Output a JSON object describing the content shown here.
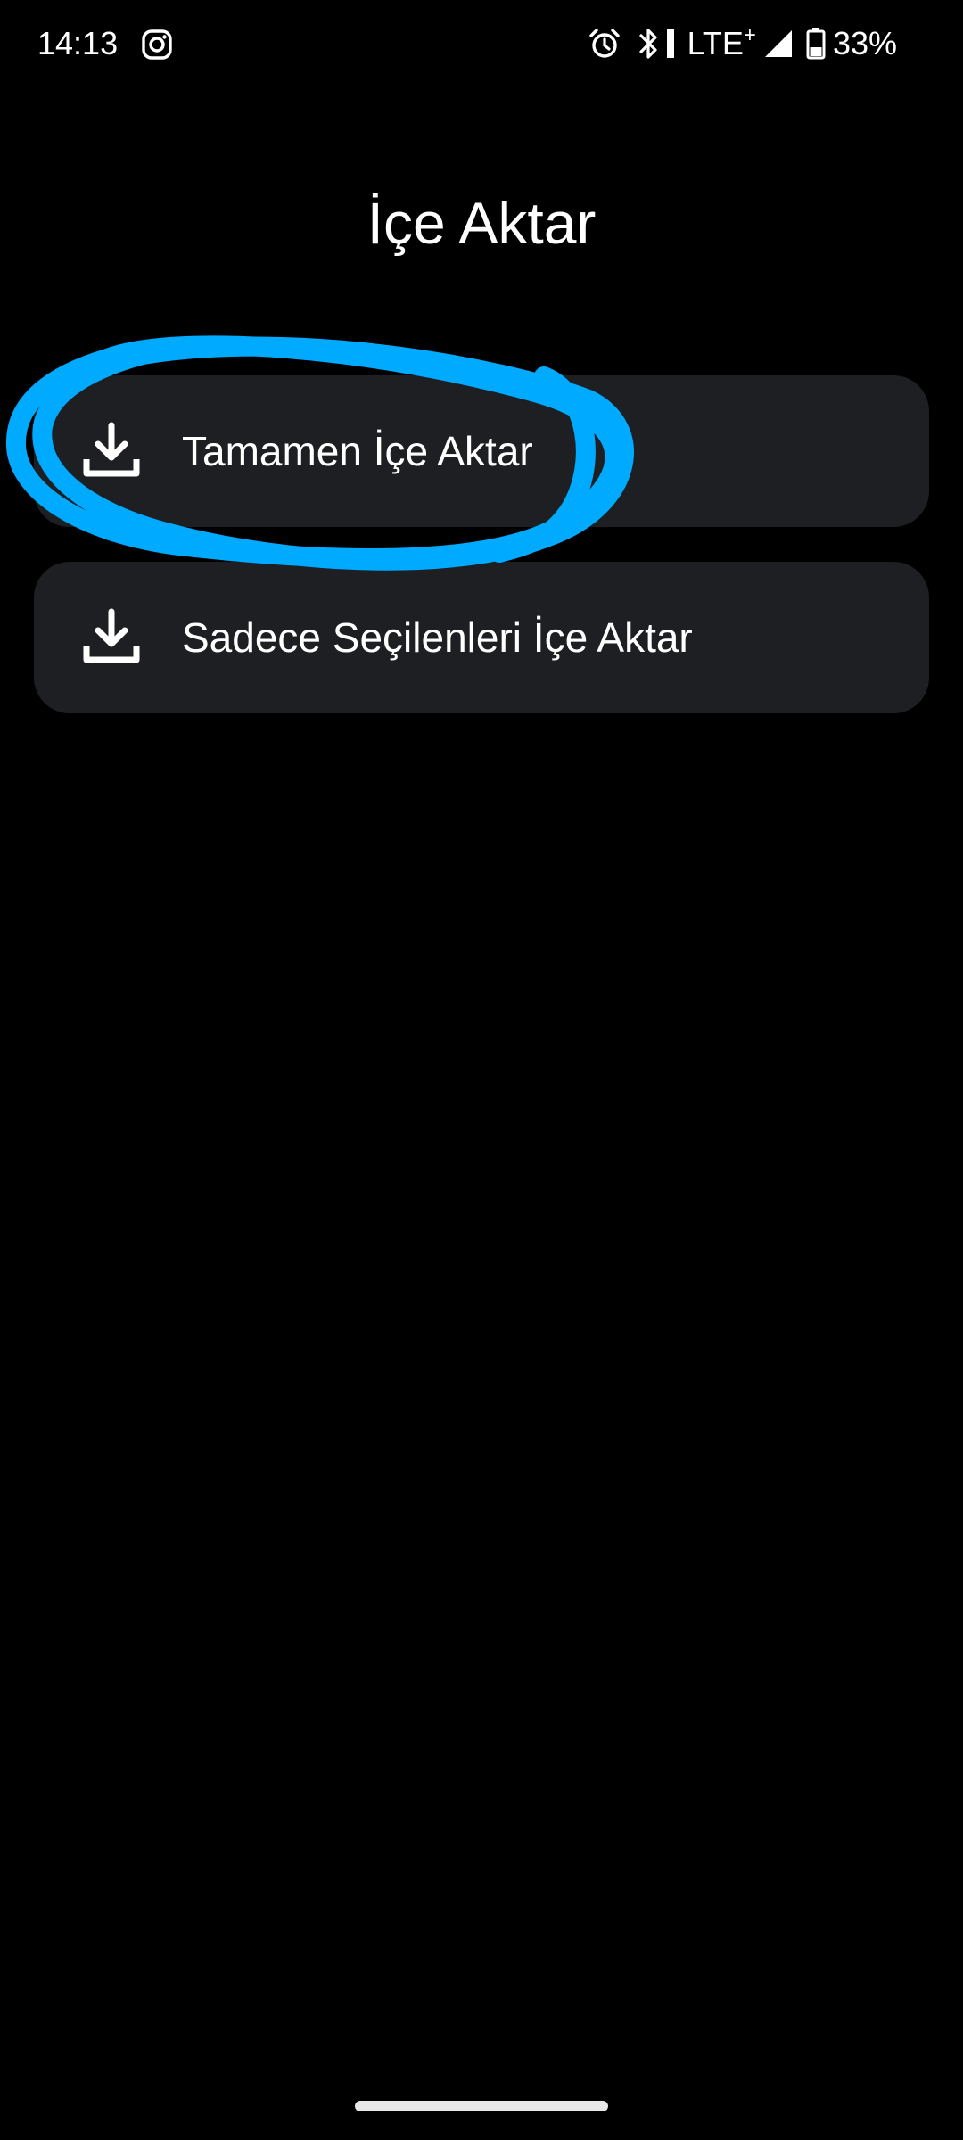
{
  "status_bar": {
    "time": "14:13",
    "network": "LTE",
    "network_plus": "+",
    "battery": "33%",
    "icons": [
      "instagram-icon",
      "alarm-icon",
      "bluetooth-icon",
      "signal-icon",
      "battery-icon"
    ]
  },
  "page": {
    "title": "İçe Aktar"
  },
  "options": [
    {
      "label": "Tamamen İçe Aktar",
      "icon": "download-icon"
    },
    {
      "label": "Sadece Seçilenleri İçe Aktar",
      "icon": "download-icon"
    }
  ],
  "colors": {
    "background": "#000000",
    "card": "#1e1f22",
    "text": "#ffffff",
    "annotation": "#00aaff"
  }
}
